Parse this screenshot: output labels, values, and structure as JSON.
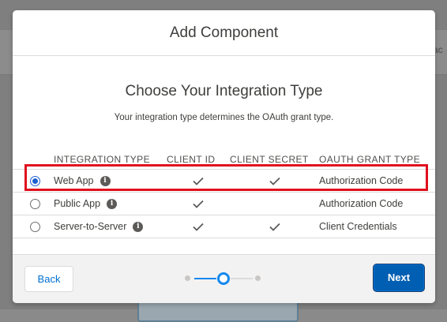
{
  "background": {
    "peek_text": "ac"
  },
  "modal": {
    "title": "Add Component",
    "body_title": "Choose Your Integration Type",
    "body_subtitle": "Your integration type determines the OAuth grant type.",
    "table": {
      "columns": [
        "INTEGRATION TYPE",
        "CLIENT ID",
        "CLIENT SECRET",
        "OAUTH GRANT TYPE"
      ],
      "rows": [
        {
          "type": "Web App",
          "selected": true,
          "client_id": true,
          "client_secret": true,
          "grant": "Authorization Code",
          "icon": "info-icon"
        },
        {
          "type": "Public App",
          "selected": false,
          "client_id": true,
          "client_secret": false,
          "grant": "Authorization Code",
          "icon": "info-icon"
        },
        {
          "type": "Server-to-Server",
          "selected": false,
          "client_id": true,
          "client_secret": true,
          "grant": "Client Credentials",
          "icon": "info-icon"
        }
      ]
    },
    "footer": {
      "back_label": "Back",
      "next_label": "Next",
      "stepper": {
        "steps": 3,
        "current": 2
      }
    }
  },
  "colors": {
    "accent": "#0070d2",
    "primary_button": "#005fb2",
    "highlight": "#e0101e",
    "stepper_active": "#1589ee"
  }
}
